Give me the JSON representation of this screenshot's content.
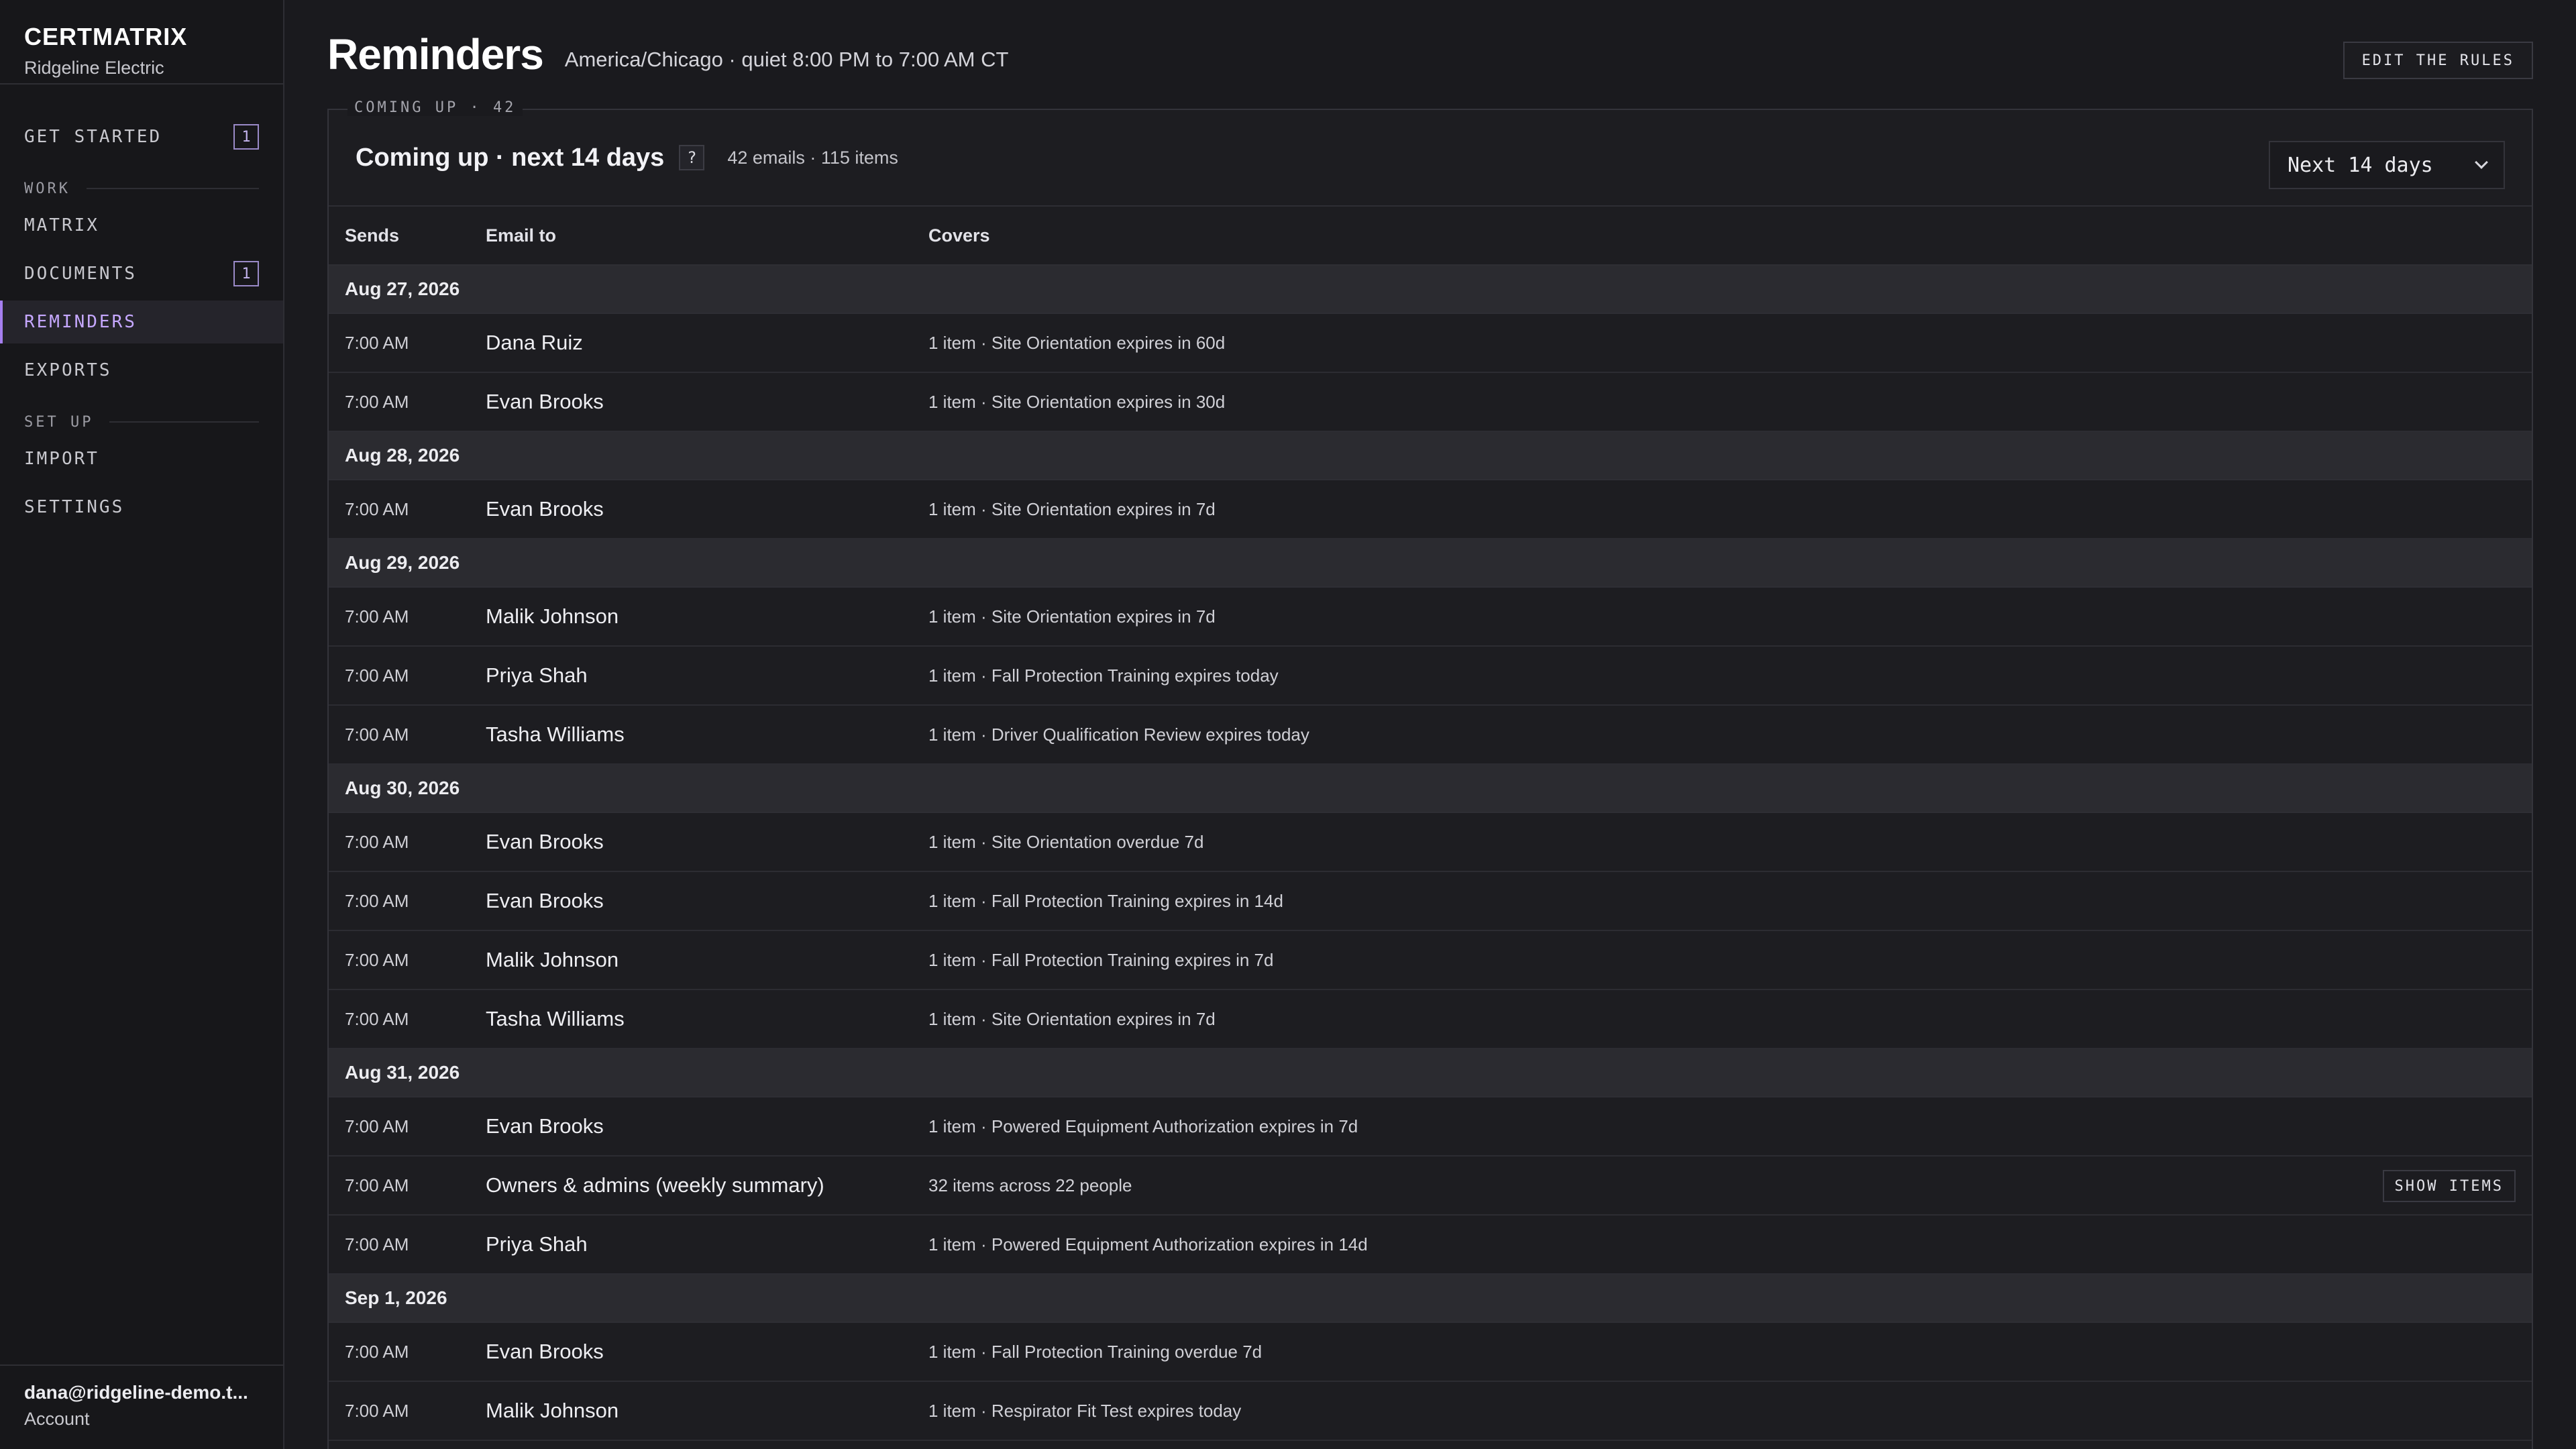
{
  "sidebar": {
    "brand": "CERTMATRIX",
    "org": "Ridgeline Electric",
    "get_started": {
      "label": "GET STARTED",
      "badge": "1"
    },
    "section_work": "WORK",
    "matrix": "MATRIX",
    "documents": {
      "label": "DOCUMENTS",
      "badge": "1"
    },
    "reminders": "REMINDERS",
    "exports": "EXPORTS",
    "section_setup": "SET UP",
    "import": "IMPORT",
    "settings": "SETTINGS",
    "account_email": "dana@ridgeline-demo.t...",
    "account_label": "Account"
  },
  "header": {
    "title": "Reminders",
    "subtitle": "America/Chicago · quiet 8:00 PM to 7:00 AM CT",
    "edit_button": "EDIT THE RULES"
  },
  "panel": {
    "legend": "COMING UP · 42",
    "title": "Coming up · next 14 days",
    "help": "?",
    "stats": "42 emails · 115 items",
    "range": "Next 14 days",
    "columns": {
      "sends": "Sends",
      "email": "Email to",
      "covers": "Covers"
    }
  },
  "groups": [
    {
      "date": "Aug 27, 2026",
      "rows": [
        {
          "time": "7:00 AM",
          "to": "Dana Ruiz",
          "covers": "1 item · Site Orientation expires in 60d"
        },
        {
          "time": "7:00 AM",
          "to": "Evan Brooks",
          "covers": "1 item · Site Orientation expires in 30d"
        }
      ]
    },
    {
      "date": "Aug 28, 2026",
      "rows": [
        {
          "time": "7:00 AM",
          "to": "Evan Brooks",
          "covers": "1 item · Site Orientation expires in 7d"
        }
      ]
    },
    {
      "date": "Aug 29, 2026",
      "rows": [
        {
          "time": "7:00 AM",
          "to": "Malik Johnson",
          "covers": "1 item · Site Orientation expires in 7d"
        },
        {
          "time": "7:00 AM",
          "to": "Priya Shah",
          "covers": "1 item · Fall Protection Training expires today"
        },
        {
          "time": "7:00 AM",
          "to": "Tasha Williams",
          "covers": "1 item · Driver Qualification Review expires today"
        }
      ]
    },
    {
      "date": "Aug 30, 2026",
      "rows": [
        {
          "time": "7:00 AM",
          "to": "Evan Brooks",
          "covers": "1 item · Site Orientation overdue 7d"
        },
        {
          "time": "7:00 AM",
          "to": "Evan Brooks",
          "covers": "1 item · Fall Protection Training expires in 14d"
        },
        {
          "time": "7:00 AM",
          "to": "Malik Johnson",
          "covers": "1 item · Fall Protection Training expires in 7d"
        },
        {
          "time": "7:00 AM",
          "to": "Tasha Williams",
          "covers": "1 item · Site Orientation expires in 7d"
        }
      ]
    },
    {
      "date": "Aug 31, 2026",
      "rows": [
        {
          "time": "7:00 AM",
          "to": "Evan Brooks",
          "covers": "1 item · Powered Equipment Authorization expires in 7d"
        },
        {
          "time": "7:00 AM",
          "to": "Owners & admins (weekly summary)",
          "covers": "32 items across 22 people",
          "action": "SHOW ITEMS"
        },
        {
          "time": "7:00 AM",
          "to": "Priya Shah",
          "covers": "1 item · Powered Equipment Authorization expires in 14d"
        }
      ]
    },
    {
      "date": "Sep 1, 2026",
      "rows": [
        {
          "time": "7:00 AM",
          "to": "Evan Brooks",
          "covers": "1 item · Fall Protection Training overdue 7d"
        },
        {
          "time": "7:00 AM",
          "to": "Malik Johnson",
          "covers": "1 item · Respirator Fit Test expires today"
        }
      ]
    }
  ]
}
